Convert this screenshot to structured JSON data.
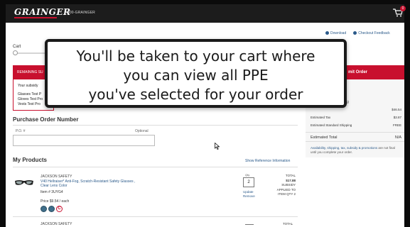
{
  "header": {
    "logo": "GRAINGER",
    "phone": "1-800-GRAINGER",
    "cart_count": "0"
  },
  "top_links": {
    "download": "Download",
    "feedback": "Checkout Feedback"
  },
  "progress": {
    "step_label": "Cart"
  },
  "remaining_panel": {
    "title": "REMAINING SU",
    "subsidy_text": "Your subsidy ",
    "items": [
      "Glasses Test P",
      "Gloves Test Pro",
      "Vests Test Pro"
    ]
  },
  "submit_order": "mit Order",
  "summary": {
    "shipping_note": "Standard Ground shipping)",
    "subtotal": "$46.54",
    "rows": [
      {
        "label": "Estimated Tax",
        "value": "$3.87"
      },
      {
        "label": "Estimated Standard Shipping",
        "value": "FREE"
      }
    ],
    "total_label": "Estimated Total",
    "total_value": "N/A",
    "note_link": "Availability, shipping, tax, subsidy & promotions",
    "note_rest": " are not final until you complete your order."
  },
  "purchase_order": {
    "title": "Purchase Order Number",
    "label": "P.O. #",
    "optional": "Optional",
    "value": ""
  },
  "products": {
    "title": "My Products",
    "show_ref": "Show Reference Information",
    "items": [
      {
        "brand": "JACKSON SAFETY",
        "name": "V40 Hellraiser* Anti-Fog, Scratch-Resistant Safety Glasses , Clear Lens Color",
        "item": "Item # 3UYG4",
        "price": "Price $9.54 / each",
        "qty_label": "Qty",
        "qty": "2",
        "update": "Update",
        "remove": "Remove",
        "total_label": "TOTAL",
        "total_amount": "$17.88",
        "subsidy": "SUBSIDY",
        "applied": "APPLIED TO",
        "applied_qty": "ITEM QTY 2"
      },
      {
        "brand": "JACKSON SAFETY",
        "total_label": "TOTAL"
      }
    ]
  },
  "overlay": {
    "lines": [
      "You'll be taken to your cart where",
      "you can view all PPE",
      "you've selected for your order"
    ]
  }
}
